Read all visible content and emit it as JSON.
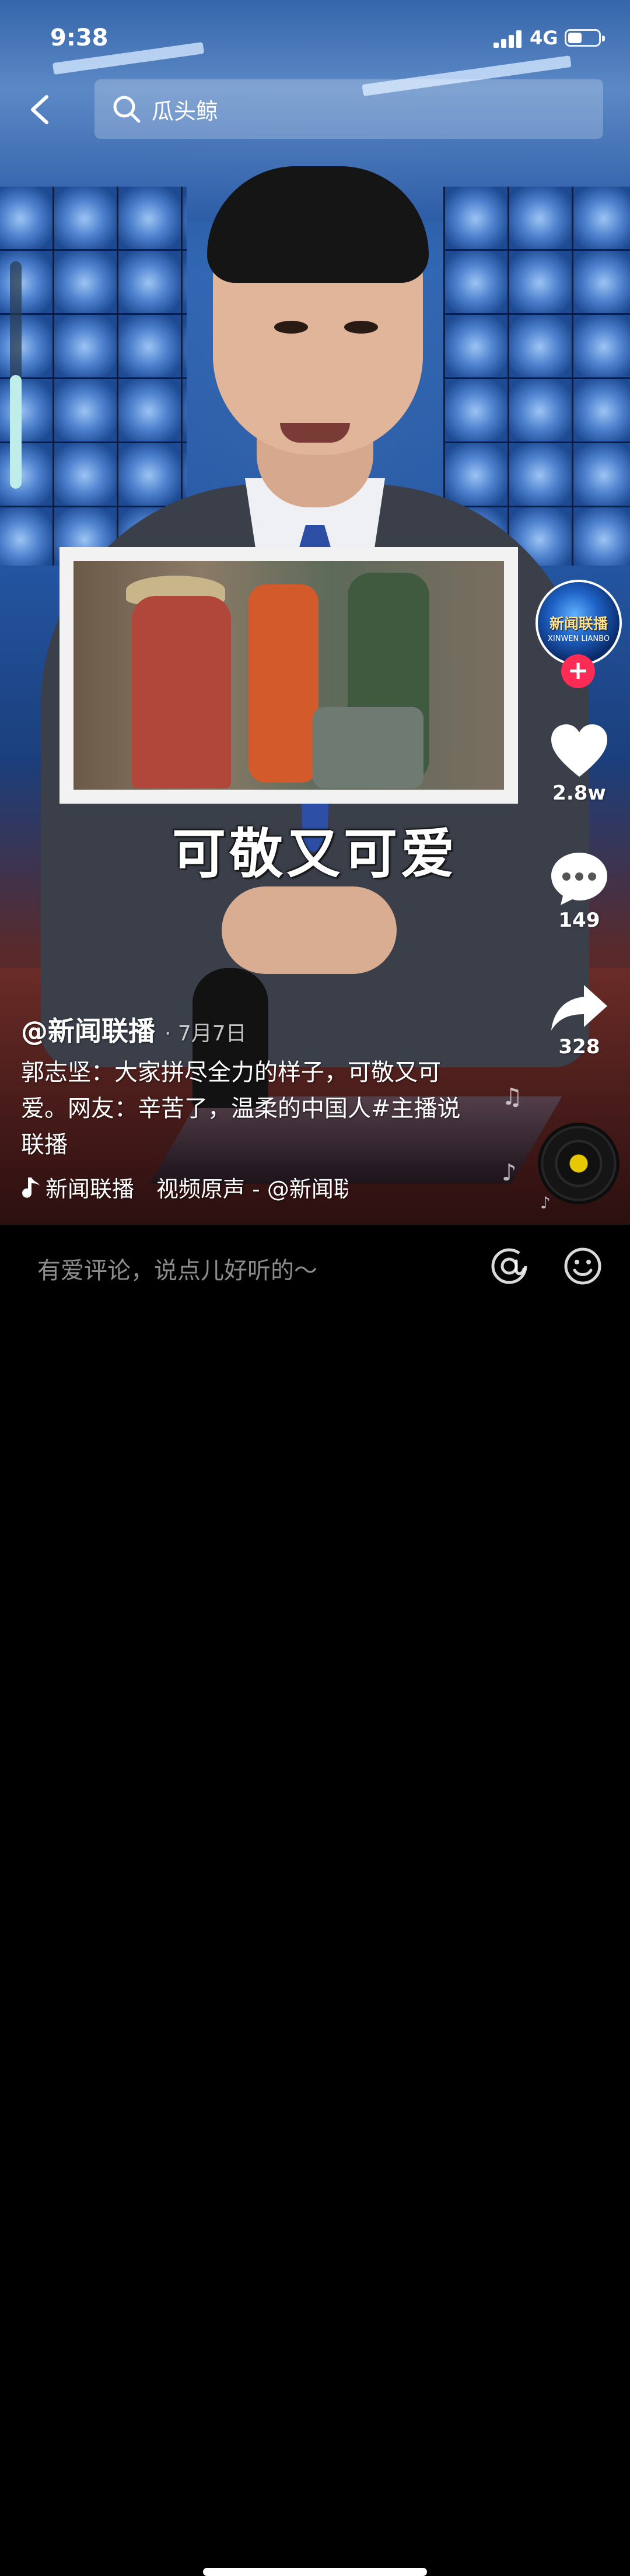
{
  "status_bar": {
    "time": "9:38",
    "network": "4G",
    "battery_level": 0.45
  },
  "search": {
    "query": "瓜头鲸"
  },
  "video": {
    "caption": "可敬又可爱",
    "progress": 0.5
  },
  "author": {
    "handle": "@新闻联播",
    "date": "· 7月7日",
    "avatar_text": "新闻联播",
    "avatar_subtext": "XINWEN LIANBO"
  },
  "description": "郭志坚：大家拼尽全力的样子，可敬又可爱。网友：辛苦了，温柔的中国人#主播说联播",
  "music": {
    "text": "新闻联播　视频原声 - @新闻联播"
  },
  "actions": {
    "likes": "2.8w",
    "comments": "149",
    "shares": "328"
  },
  "comment_bar": {
    "placeholder": "有爱评论，说点儿好听的～"
  },
  "colors": {
    "follow": "#fe2c55",
    "disc_center": "#e6c800",
    "progress": "#bfeeea"
  },
  "icons": [
    "back-icon",
    "search-icon",
    "heart-icon",
    "comment-icon",
    "share-icon",
    "music-note-icon",
    "at-icon",
    "emoji-icon"
  ]
}
